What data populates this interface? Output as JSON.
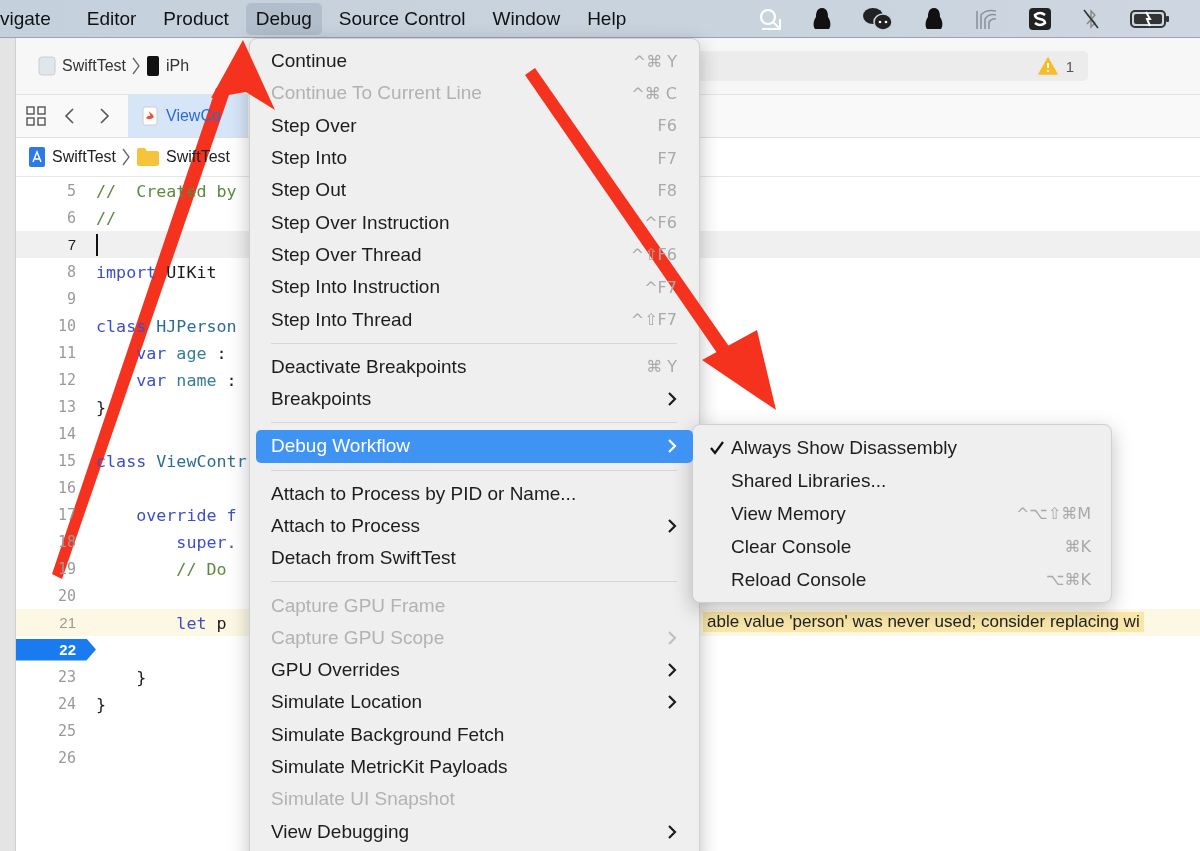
{
  "menu_bar": {
    "items": [
      {
        "label": "vigate",
        "selected": false
      },
      {
        "label": "Editor",
        "selected": false
      },
      {
        "label": "Product",
        "selected": false
      },
      {
        "label": "Debug",
        "selected": true
      },
      {
        "label": "Source Control",
        "selected": false
      },
      {
        "label": "Window",
        "selected": false
      },
      {
        "label": "Help",
        "selected": false
      }
    ]
  },
  "toolbar": {
    "scheme": "SwiftTest",
    "destination": "iPh",
    "warning_count": "1"
  },
  "tab_bar": {
    "tabs": [
      {
        "label": "ViewCo",
        "selected": true
      }
    ]
  },
  "jump_bar": {
    "items": [
      {
        "kind": "project",
        "label": "SwiftTest"
      },
      {
        "kind": "folder",
        "label": "SwiftTest"
      }
    ]
  },
  "editor": {
    "warning_message": "able value 'person' was never used; consider replacing wi",
    "lines": [
      {
        "number": "5",
        "kind": "code",
        "segments": [
          {
            "kind": "comment",
            "text": "//  Created by"
          }
        ]
      },
      {
        "number": "6",
        "kind": "code",
        "segments": [
          {
            "kind": "comment",
            "text": "//"
          }
        ]
      },
      {
        "number": "7",
        "kind": "current"
      },
      {
        "number": "8",
        "kind": "code",
        "segments": [
          {
            "kind": "keyword",
            "text": "import"
          },
          {
            "kind": "plain",
            "text": " UIKit"
          }
        ]
      },
      {
        "number": "9",
        "kind": "code"
      },
      {
        "number": "10",
        "kind": "code",
        "segments": [
          {
            "kind": "keyword",
            "text": "class"
          },
          {
            "kind": "type",
            "text": " HJPerson"
          }
        ]
      },
      {
        "number": "11",
        "kind": "code",
        "segments": [
          {
            "kind": "keyword",
            "text": "    var"
          },
          {
            "kind": "identifier",
            "text": " age"
          },
          {
            "kind": "plain",
            "text": " :"
          }
        ]
      },
      {
        "number": "12",
        "kind": "code",
        "segments": [
          {
            "kind": "keyword",
            "text": "    var"
          },
          {
            "kind": "identifier",
            "text": " name"
          },
          {
            "kind": "plain",
            "text": " :"
          }
        ]
      },
      {
        "number": "13",
        "kind": "code",
        "segments": [
          {
            "kind": "plain",
            "text": "}"
          }
        ]
      },
      {
        "number": "14",
        "kind": "code"
      },
      {
        "number": "15",
        "kind": "code",
        "segments": [
          {
            "kind": "keyword",
            "text": "class"
          },
          {
            "kind": "type",
            "text": " ViewContr"
          }
        ]
      },
      {
        "number": "16",
        "kind": "code"
      },
      {
        "number": "17",
        "kind": "code",
        "segments": [
          {
            "kind": "keyword",
            "text": "    override f"
          }
        ]
      },
      {
        "number": "18",
        "kind": "code",
        "segments": [
          {
            "kind": "keyword",
            "text": "        super."
          }
        ]
      },
      {
        "number": "19",
        "kind": "code",
        "segments": [
          {
            "kind": "comment",
            "text": "        // Do"
          }
        ]
      },
      {
        "number": "20",
        "kind": "code"
      },
      {
        "number": "21",
        "kind": "warning",
        "segments": [
          {
            "kind": "keyword",
            "text": "        let"
          },
          {
            "kind": "plain",
            "text": " p"
          }
        ]
      },
      {
        "number": "22",
        "kind": "breakpoint"
      },
      {
        "number": "23",
        "kind": "code",
        "segments": [
          {
            "kind": "plain",
            "text": "    }"
          }
        ]
      },
      {
        "number": "24",
        "kind": "code",
        "segments": [
          {
            "kind": "plain",
            "text": "}"
          }
        ]
      },
      {
        "number": "25",
        "kind": "code"
      },
      {
        "number": "26",
        "kind": "code"
      }
    ]
  },
  "debug_menu": {
    "items": [
      {
        "kind": "item",
        "label": "Continue",
        "shortcut": "^⌘ Y",
        "disabled": false,
        "selected": false,
        "submenu": false
      },
      {
        "kind": "item",
        "label": "Continue To Current Line",
        "shortcut": "^⌘ C",
        "disabled": true,
        "selected": false,
        "submenu": false
      },
      {
        "kind": "item",
        "label": "Step Over",
        "shortcut": "F6",
        "disabled": false,
        "selected": false,
        "submenu": false
      },
      {
        "kind": "item",
        "label": "Step Into",
        "shortcut": "F7",
        "disabled": false,
        "selected": false,
        "submenu": false
      },
      {
        "kind": "item",
        "label": "Step Out",
        "shortcut": "F8",
        "disabled": false,
        "selected": false,
        "submenu": false
      },
      {
        "kind": "item",
        "label": "Step Over Instruction",
        "shortcut": "^F6",
        "disabled": false,
        "selected": false,
        "submenu": false
      },
      {
        "kind": "item",
        "label": "Step Over Thread",
        "shortcut": "^⇧F6",
        "disabled": false,
        "selected": false,
        "submenu": false
      },
      {
        "kind": "item",
        "label": "Step Into Instruction",
        "shortcut": "^F7",
        "disabled": false,
        "selected": false,
        "submenu": false
      },
      {
        "kind": "item",
        "label": "Step Into Thread",
        "shortcut": "^⇧F7",
        "disabled": false,
        "selected": false,
        "submenu": false
      },
      {
        "kind": "separator"
      },
      {
        "kind": "item",
        "label": "Deactivate Breakpoints",
        "shortcut": "⌘ Y",
        "disabled": false,
        "selected": false,
        "submenu": false
      },
      {
        "kind": "item",
        "label": "Breakpoints",
        "disabled": false,
        "selected": false,
        "submenu": true
      },
      {
        "kind": "separator"
      },
      {
        "kind": "item",
        "label": "Debug Workflow",
        "disabled": false,
        "selected": true,
        "submenu": true
      },
      {
        "kind": "separator"
      },
      {
        "kind": "item",
        "label": "Attach to Process by PID or Name...",
        "disabled": false,
        "selected": false,
        "submenu": false
      },
      {
        "kind": "item",
        "label": "Attach to Process",
        "disabled": false,
        "selected": false,
        "submenu": true
      },
      {
        "kind": "item",
        "label": "Detach from SwiftTest",
        "disabled": false,
        "selected": false,
        "submenu": false
      },
      {
        "kind": "separator"
      },
      {
        "kind": "item",
        "label": "Capture GPU Frame",
        "disabled": true,
        "selected": false,
        "submenu": false
      },
      {
        "kind": "item",
        "label": "Capture GPU Scope",
        "disabled": true,
        "selected": false,
        "submenu": true
      },
      {
        "kind": "item",
        "label": "GPU Overrides",
        "disabled": false,
        "selected": false,
        "submenu": true
      },
      {
        "kind": "item",
        "label": "Simulate Location",
        "disabled": false,
        "selected": false,
        "submenu": true
      },
      {
        "kind": "item",
        "label": "Simulate Background Fetch",
        "disabled": false,
        "selected": false,
        "submenu": false
      },
      {
        "kind": "item",
        "label": "Simulate MetricKit Payloads",
        "disabled": false,
        "selected": false,
        "submenu": false
      },
      {
        "kind": "item",
        "label": "Simulate UI Snapshot",
        "disabled": true,
        "selected": false,
        "submenu": false
      },
      {
        "kind": "item",
        "label": "View Debugging",
        "disabled": false,
        "selected": false,
        "submenu": true
      }
    ]
  },
  "workflow_submenu": {
    "items": [
      {
        "label": "Always Show Disassembly",
        "checked": true,
        "selected": false
      },
      {
        "label": "Shared Libraries...",
        "checked": false,
        "selected": false
      },
      {
        "label": "View Memory",
        "shortcut": "^⌥⇧⌘M",
        "checked": false,
        "selected": false
      },
      {
        "label": "Clear Console",
        "shortcut": "⌘K",
        "checked": false,
        "selected": false
      },
      {
        "label": "Reload Console",
        "shortcut": "⌥⌘K",
        "checked": false,
        "selected": false
      }
    ]
  }
}
